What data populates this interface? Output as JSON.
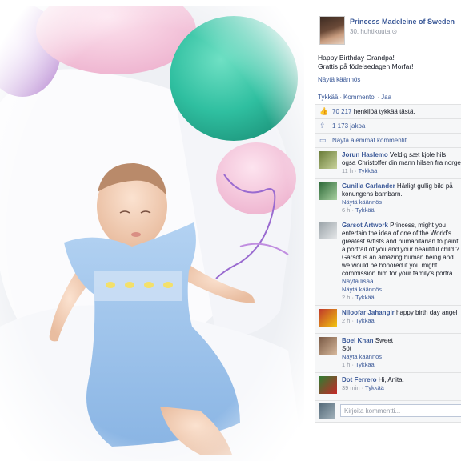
{
  "post": {
    "author": "Princess Madeleine of Sweden",
    "date": "30. huhtikuuta",
    "globe": "⊙",
    "text_line1": "Happy Birthday Grandpa!",
    "text_line2": "Grattis på födelsedagen Morfar!",
    "translate": "Näytä käännös",
    "actions": {
      "like": "Tykkää",
      "comment": "Kommentoi",
      "share": "Jaa",
      "sep": "·"
    },
    "likes": {
      "count": "70 217",
      "text": "henkilöä tykkää tästä."
    },
    "shares": "1 173 jakoa",
    "previous_comments": "Näytä aiemmat kommentit",
    "comment_placeholder": "Kirjoita kommentti..."
  },
  "comments": [
    {
      "author": "Jorun Haslemo",
      "text": "Veldig sæt kjole hils ogsa Christoffer din mann hilsen fra norge",
      "extra": "",
      "time": "11 h",
      "like": "Tykkää"
    },
    {
      "author": "Gunilla Carlander",
      "text": "Härligt gullig bild på konungens barnbarn.",
      "extra": "Näytä käännös",
      "time": "6 h",
      "like": "Tykkää"
    },
    {
      "author": "Garsot Artwork",
      "text": "Princess, might you entertain the idea of one of the World's greatest Artists and humanitarian to paint a portrait of you and your beautiful child ? Garsot is an amazing human being and we would be honored if you might commission him for your family's portra...",
      "more": "Näytä lisää",
      "extra": "Näytä käännös",
      "time": "2 h",
      "like": "Tykkää"
    },
    {
      "author": "Niloofar Jahangir",
      "text": "happy birth day angel",
      "extra": "",
      "time": "2 h",
      "like": "Tykkää"
    },
    {
      "author": "Boel Khan",
      "text": "Sweet",
      "text2": "Söt",
      "extra": "Näytä käännös",
      "time": "1 h",
      "like": "Tykkää"
    },
    {
      "author": "Dot Ferrero",
      "text": "Hi, Anita.",
      "extra": "",
      "time": "39 min",
      "like": "Tykkää"
    }
  ],
  "colors": {
    "link": "#3b5998",
    "meta": "#9197a3",
    "ufi_bg": "#f6f7f8",
    "balloon_teal": "#2fbfa0",
    "balloon_pink": "#f3c1d8",
    "dress": "#9cc3ea"
  },
  "icons": {
    "like": "thumbs-up-icon",
    "share": "share-icon",
    "comments": "comment-bubble-icon"
  }
}
